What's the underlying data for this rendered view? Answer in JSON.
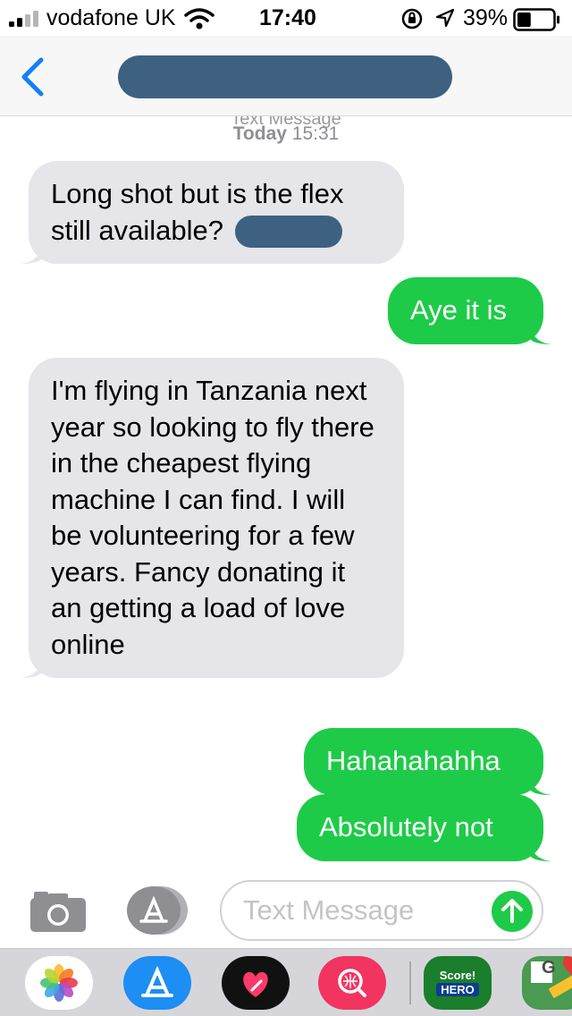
{
  "status_bar": {
    "carrier": "vodafone UK",
    "time": "17:40",
    "battery_percent": "39%",
    "battery_level": 0.39,
    "signal_bars": 2
  },
  "nav": {
    "back_icon": "chevron-left-icon"
  },
  "conversation": {
    "cutoff_header": "Text Message",
    "day": "Today",
    "time": "15:31",
    "messages": [
      {
        "direction": "received",
        "text": "Long shot but is the flex still available? "
      },
      {
        "direction": "sent",
        "text": "Aye it is"
      },
      {
        "direction": "received",
        "text": "I'm flying in Tanzania next year so looking to fly there in the cheapest flying machine I can find. I will be volunteering for a few years. Fancy donating it an getting a load of love online"
      },
      {
        "direction": "sent",
        "text": "Hahahahahha"
      },
      {
        "direction": "sent",
        "text": "Absolutely not"
      }
    ]
  },
  "input": {
    "placeholder": "Text Message",
    "camera_icon": "camera-icon",
    "apps_icon": "app-store-icon",
    "send_icon": "send-arrow-icon"
  },
  "drawer": {
    "apps": [
      "photos-icon",
      "app-store-icon",
      "digital-touch-icon",
      "image-search-icon",
      "score-hero-icon",
      "google-maps-icon"
    ],
    "score_app_line1": "Score!",
    "score_app_line2": "HERO",
    "maps_letter": "G"
  },
  "colors": {
    "sent_bubble": "#1ecb48",
    "received_bubble": "#e5e5ea",
    "ios_blue": "#147efb",
    "redaction": "#3e6181"
  }
}
